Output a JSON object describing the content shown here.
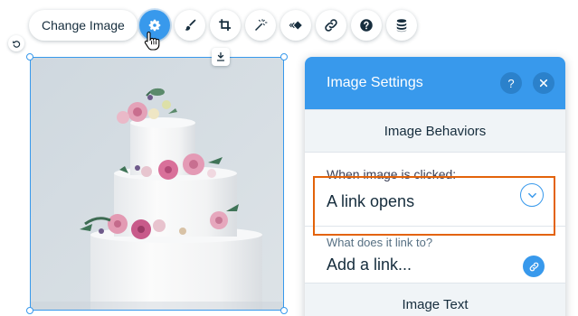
{
  "toolbar": {
    "change_image_label": "Change Image",
    "tools": [
      "settings-icon",
      "brush-icon",
      "crop-icon",
      "magic-wand-icon",
      "animation-icon",
      "link-icon",
      "help-icon",
      "stack-icon"
    ]
  },
  "panel": {
    "title": "Image Settings",
    "help_label": "?",
    "section_behaviors": "Image Behaviors",
    "click_label": "When image is clicked:",
    "click_value": "A link opens",
    "link_label": "What does it link to?",
    "link_value": "Add a link...",
    "section_text": "Image Text"
  },
  "colors": {
    "accent": "#3899ec",
    "highlight": "#e3630a",
    "text": "#162d3d",
    "section_bg": "#f0f4f7"
  }
}
